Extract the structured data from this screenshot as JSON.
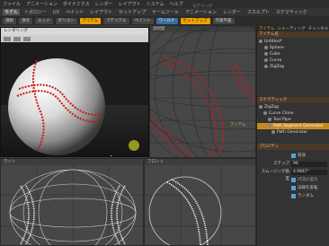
{
  "menubar": {
    "items": [
      "ファイル",
      "アニメーション",
      "ダイナミクス",
      "レンダー",
      "レイアウト",
      "システム",
      "ヘルプ"
    ]
  },
  "modetabs": [
    "モデル",
    "トポロジー",
    "UV",
    "ペイント",
    "レイアウト",
    "セットアップ",
    "ゲームツール",
    "アニメーション",
    "レンダー",
    "スカルプト",
    "スケマティック"
  ],
  "toolbar": {
    "items": [
      "選択",
      "頂点",
      "エッジ",
      "ポリゴン",
      "アイテム",
      "マテリアル",
      "ペイント",
      "ワールド",
      "セットアップ",
      "作業平面"
    ]
  },
  "render_window": {
    "title": "レンダリング"
  },
  "right_panel": {
    "tabs": [
      "アイテム",
      "シェーディング",
      "チャンネル"
    ],
    "items_header": "アイテム名",
    "items": [
      {
        "label": "Untitled*",
        "selected": false
      },
      {
        "label": "Sphere",
        "selected": false
      },
      {
        "label": "Cube",
        "selected": false
      },
      {
        "label": "Curve",
        "selected": false
      },
      {
        "label": "ZigZag",
        "selected": false
      }
    ],
    "schematic_header": "スケマティック",
    "schematic_items": [
      {
        "label": "ZigZag",
        "selected": false
      },
      {
        "label": "Curve Clone",
        "selected": false
      },
      {
        "label": "Tool Pipe",
        "selected": false
      },
      {
        "label": "Path Segment Generator",
        "selected": true
      },
      {
        "label": "Path Generator",
        "selected": false
      }
    ],
    "props_header": "プロパティ",
    "props": [
      {
        "label": "有効",
        "type": "check"
      },
      {
        "label": "ステップ",
        "value": "96"
      },
      {
        "label": "スムージング角度",
        "value": "4.0847°"
      },
      {
        "label": "パスに沿う",
        "type": "check"
      },
      {
        "label": "法線を反転",
        "type": "check"
      },
      {
        "label": "ランダム",
        "type": "check"
      }
    ]
  },
  "viewports": {
    "top_right_label": "透視図",
    "bottom_left_label": "ライト",
    "bottom_mid_label": "フロント"
  },
  "status_text": "アイテム",
  "colors": {
    "accent": "#f0a000",
    "seam": "#d01818",
    "selection": "#c88a20"
  }
}
